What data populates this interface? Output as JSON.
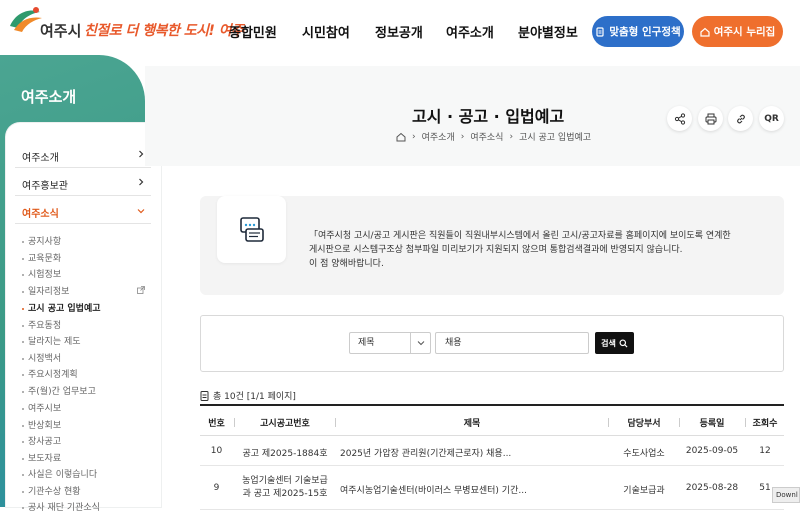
{
  "header": {
    "logo_text": "여주시",
    "slogan": "친절로 더 행복한 도시! 여주",
    "nav": [
      "종합민원",
      "시민참여",
      "정보공개",
      "여주소개",
      "분야별정보"
    ],
    "btn_policy": "맞춤형 인구정책",
    "btn_nurizip": "여주시 누리집"
  },
  "sidebar": {
    "title": "여주소개",
    "menu": [
      "여주소개",
      "여주홍보관",
      "여주소식"
    ],
    "sub": [
      "공지사항",
      "교육문화",
      "시험정보",
      "일자리정보",
      "고시 공고 입법예고",
      "주요동정",
      "달라지는 제도",
      "시정백서",
      "주요시정계획",
      "주(월)간 업무보고",
      "여주시보",
      "반상회보",
      "장사공고",
      "보도자료",
      "사실은 이렇습니다",
      "기관수상 현황",
      "공사 재단 기관소식"
    ]
  },
  "page": {
    "title": "고시 · 공고 · 입법예고",
    "breadcrumb": [
      "여주소개",
      "여주소식",
      "고시 공고 입법예고"
    ],
    "tools": {
      "qr": "QR"
    }
  },
  "notice": {
    "line1": "「여주시청 고시/공고 게시판은 직원들이 직원내부시스템에서 올린 고시/공고자료를 홈페이지에 보이도록 연계한",
    "line2": "게시판으로 시스템구조상 첨부파일 미리보기가 지원되지 않으며 통합검색결과에 반영되지 않습니다.",
    "line3": "이 점 양해바랍니다."
  },
  "search": {
    "field": "제목",
    "keyword": "채용",
    "button": "검색"
  },
  "count": "총 10건  [1/1 페이지]",
  "table": {
    "headers": [
      "번호",
      "고시공고번호",
      "제목",
      "담당부서",
      "등록일",
      "조회수"
    ],
    "rows": [
      {
        "no": "10",
        "code1": "공고 제2025-1884호",
        "code2": "",
        "title": "2025년 가압장 관리원(기간제근로자) 채용...",
        "dept": "수도사업소",
        "date": "2025-09-05",
        "views": "12"
      },
      {
        "no": "9",
        "code1": "농업기술센터 기술보급",
        "code2": "과 공고 제2025-15호",
        "title": "여주시농업기술센터(바이러스 무병묘센터) 기간...",
        "dept": "기술보급과",
        "date": "2025-08-28",
        "views": "51"
      }
    ]
  },
  "download_tab": "Downl"
}
